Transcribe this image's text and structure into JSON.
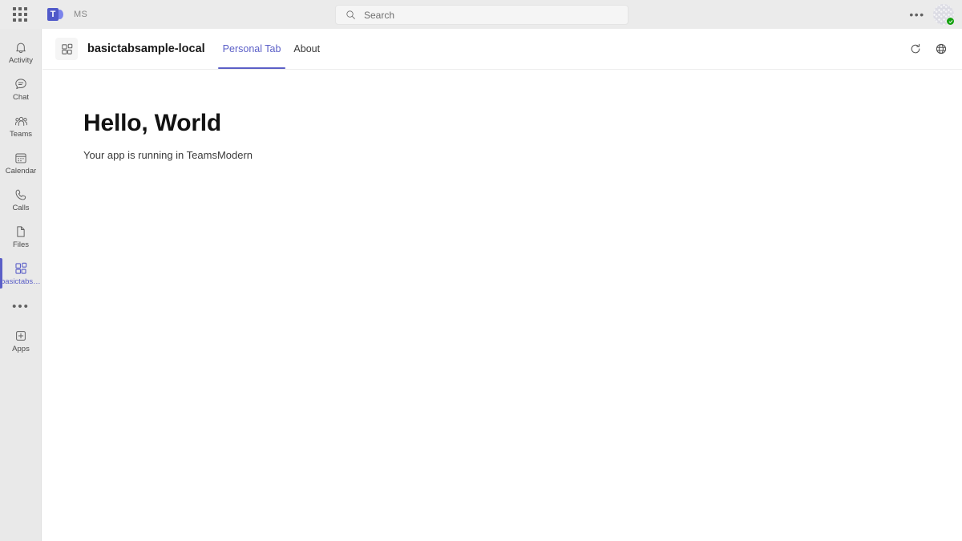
{
  "topbar": {
    "waffle_icon": "grid-apps-icon",
    "logo_icon": "teams-logo-icon",
    "logo_letter": "T",
    "org_label": "MS",
    "search": {
      "icon": "search-icon",
      "placeholder": "Search",
      "value": ""
    },
    "more_label": "•••",
    "more_icon": "more-horizontal-icon",
    "avatar_icon": "avatar",
    "presence_status": "available"
  },
  "rail": {
    "items": [
      {
        "label": "Activity",
        "icon": "bell-icon",
        "active": false
      },
      {
        "label": "Chat",
        "icon": "chat-bubble-icon",
        "active": false
      },
      {
        "label": "Teams",
        "icon": "people-icon",
        "active": false
      },
      {
        "label": "Calendar",
        "icon": "calendar-icon",
        "active": false
      },
      {
        "label": "Calls",
        "icon": "phone-icon",
        "active": false
      },
      {
        "label": "Files",
        "icon": "file-icon",
        "active": false
      },
      {
        "label": "basictabsa...",
        "icon": "app-blocks-icon",
        "active": true
      }
    ],
    "more_label": "•••",
    "more_icon": "more-horizontal-icon",
    "apps_label": "Apps",
    "apps_icon": "apps-plus-icon"
  },
  "app_header": {
    "icon": "app-blocks-icon",
    "title": "basictabsample-local",
    "tabs": [
      {
        "label": "Personal Tab",
        "active": true
      },
      {
        "label": "About",
        "active": false
      }
    ],
    "refresh_icon": "refresh-icon",
    "website_icon": "globe-icon"
  },
  "content": {
    "heading": "Hello, World",
    "subtitle": "Your app is running in TeamsModern"
  },
  "colors": {
    "accent": "#5b5fc7",
    "topbar_bg": "#ebebeb",
    "rail_bg": "#e9e9e9",
    "content_bg": "#ffffff",
    "presence_green": "#13a10e",
    "teams_blue": "#5059c9"
  }
}
